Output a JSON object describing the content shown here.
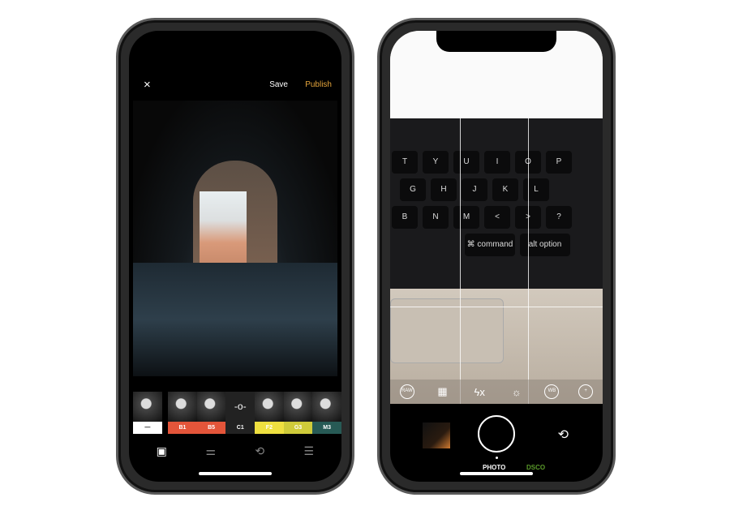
{
  "editor": {
    "close_icon": "×",
    "save_label": "Save",
    "publish_label": "Publish",
    "filters": [
      {
        "label": "—",
        "color": "#ffffff",
        "text_color": "#000000"
      },
      {
        "label": "B1",
        "color": "#e4553a",
        "text_color": "#ffffff"
      },
      {
        "label": "B5",
        "color": "#e4553a",
        "text_color": "#ffffff"
      },
      {
        "label": "C1",
        "color": "#222222",
        "text_color": "#ffffff",
        "selected": true
      },
      {
        "label": "F2",
        "color": "#efe040",
        "text_color": "#ffffff"
      },
      {
        "label": "G3",
        "color": "#cfcb3a",
        "text_color": "#ffffff"
      },
      {
        "label": "M3",
        "color": "#275a55",
        "text_color": "#ffffff"
      }
    ],
    "nav_icons": [
      "frame-icon",
      "sliders-icon",
      "history-icon",
      "recipes-icon"
    ]
  },
  "camera": {
    "keys": [
      [
        "T",
        "Y",
        "U",
        "I",
        "O",
        "P"
      ],
      [
        "G",
        "H",
        "J",
        "K",
        "L"
      ],
      [
        "B",
        "N",
        "M",
        "<",
        ">",
        "?"
      ],
      [
        "⌘ command",
        "alt option"
      ]
    ],
    "tools": [
      {
        "icon": "raw-icon",
        "label": "RAW"
      },
      {
        "icon": "grid-icon",
        "label": "▦"
      },
      {
        "icon": "flash-off-icon",
        "label": "ϟx"
      },
      {
        "icon": "exposure-icon",
        "label": "☼"
      },
      {
        "icon": "white-balance-icon",
        "label": "WB"
      },
      {
        "icon": "plus-icon",
        "label": "+"
      }
    ],
    "flip_icon": "⟲",
    "modes": {
      "photo": "PHOTO",
      "dsco": "DSCO"
    },
    "dsco_color": "#5a9a2a"
  }
}
